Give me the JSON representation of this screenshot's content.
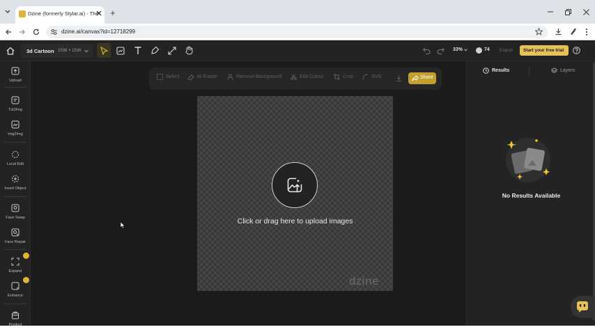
{
  "browser": {
    "tab_title": "Dzine (formerly Stylar.ai) - The",
    "new_tab_symbol": "+",
    "url": "dzine.ai/canvas?id=12718299"
  },
  "topbar": {
    "project_name": "3d Cartoon",
    "canvas_size": "1536 × 1536",
    "zoom": "33%",
    "credits": "74",
    "export_label": "Export",
    "trial_label": "Start your free trial"
  },
  "sidebar": {
    "items": [
      {
        "label": "Upload"
      },
      {
        "label": "Txt2Img"
      },
      {
        "label": "Img2Img"
      },
      {
        "label": "Local Edit"
      },
      {
        "label": "Insert Object"
      },
      {
        "label": "Face Swap"
      },
      {
        "label": "Face Repair"
      },
      {
        "label": "Expand"
      },
      {
        "label": "Enhance"
      },
      {
        "label": "Product"
      }
    ]
  },
  "toolbar": {
    "items": [
      {
        "label": "Select"
      },
      {
        "label": "AI Eraser"
      },
      {
        "label": "Remove Background"
      },
      {
        "label": "Edit Cutout"
      },
      {
        "label": "Crop"
      },
      {
        "label": "SVG"
      }
    ],
    "share_label": "Share"
  },
  "canvas": {
    "upload_text": "Click or drag here to upload images",
    "watermark": "dzine"
  },
  "right_panel": {
    "tab_results": "Results",
    "tab_layers": "Layers",
    "empty_text": "No Results Available"
  },
  "colors": {
    "accent": "#c2a02f",
    "app_bg": "#1b1b1b",
    "panel_bg": "#232323"
  }
}
